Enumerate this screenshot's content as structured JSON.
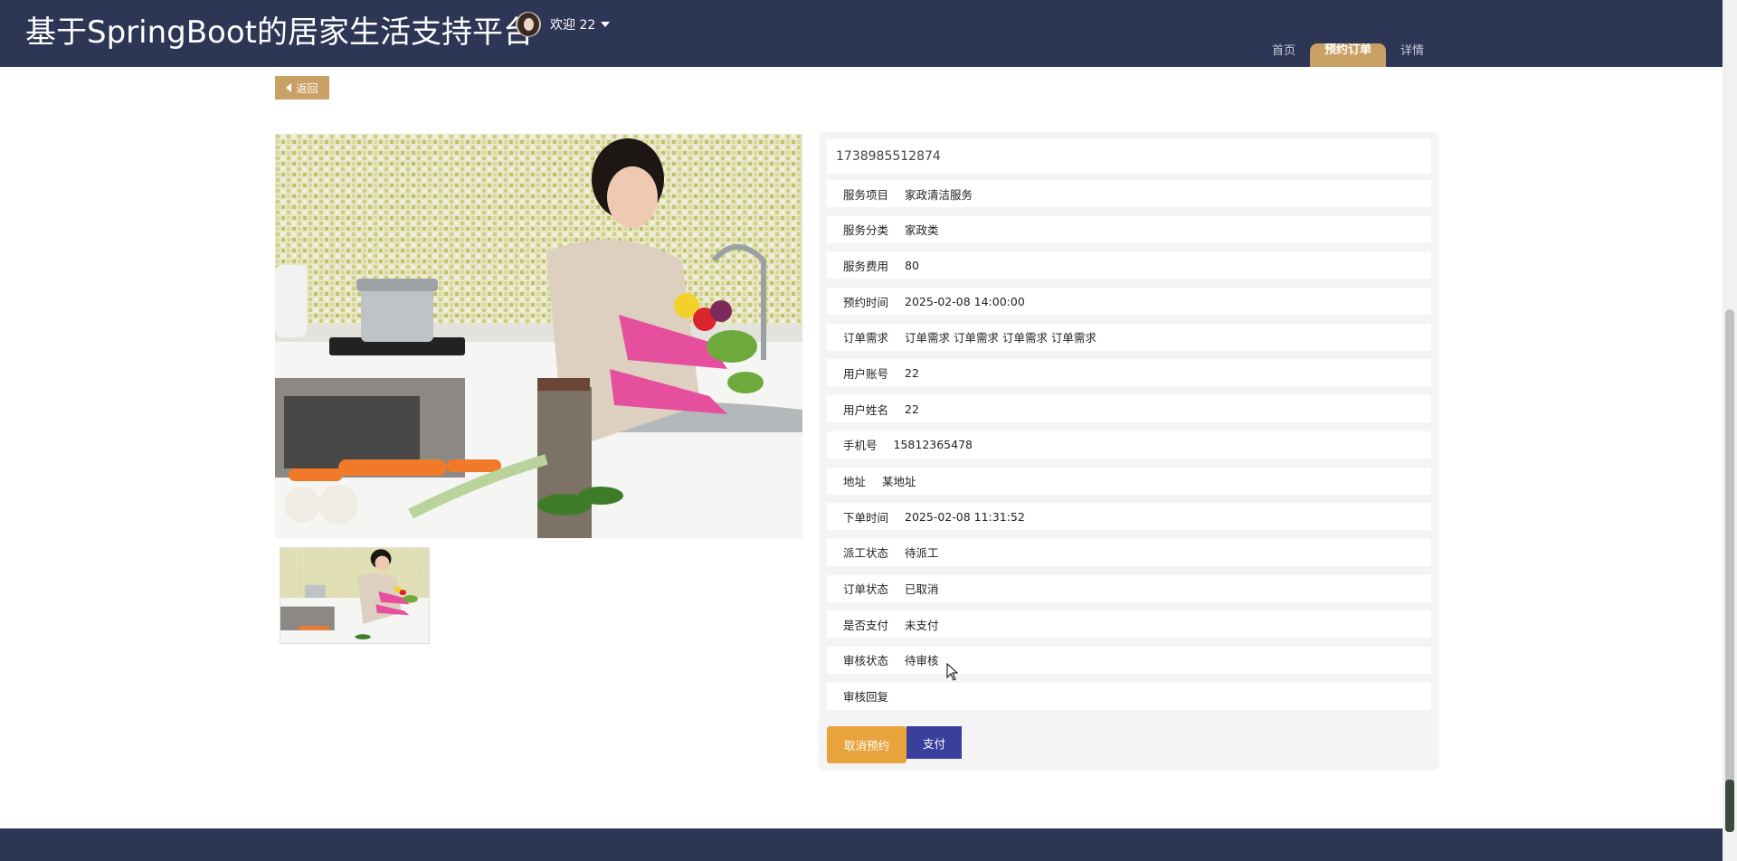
{
  "header": {
    "site_title": "基于SpringBoot的居家生活支持平台",
    "welcome_text": "欢迎 22",
    "nav": [
      {
        "label": "首页",
        "active": false
      },
      {
        "label": "预约订单",
        "active": true
      },
      {
        "label": "详情",
        "active": false
      }
    ]
  },
  "back_button": {
    "label": "返回"
  },
  "image": {
    "alt": "家政清洁服务"
  },
  "order": {
    "order_no": "1738985512874",
    "fields": [
      {
        "label": "服务项目",
        "value": "家政清洁服务"
      },
      {
        "label": "服务分类",
        "value": "家政类"
      },
      {
        "label": "服务费用",
        "value": "80"
      },
      {
        "label": "预约时间",
        "value": "2025-02-08 14:00:00"
      },
      {
        "label": "订单需求",
        "value": "订单需求 订单需求 订单需求 订单需求"
      },
      {
        "label": "用户账号",
        "value": "22"
      },
      {
        "label": "用户姓名",
        "value": "22"
      },
      {
        "label": "手机号",
        "value": "15812365478"
      },
      {
        "label": "地址",
        "value": "某地址"
      },
      {
        "label": "下单时间",
        "value": "2025-02-08 11:31:52"
      },
      {
        "label": "派工状态",
        "value": "待派工"
      },
      {
        "label": "订单状态",
        "value": "已取消"
      },
      {
        "label": "是否支付",
        "value": "未支付"
      },
      {
        "label": "审核状态",
        "value": "待审核"
      },
      {
        "label": "审核回复",
        "value": ""
      }
    ]
  },
  "actions": {
    "cancel_label": "取消预约",
    "pay_label": "支付"
  },
  "colors": {
    "header_bg": "#2e3656",
    "accent": "#c9a165",
    "cancel_btn": "#e8a33c",
    "pay_btn": "#3a3f9c"
  }
}
